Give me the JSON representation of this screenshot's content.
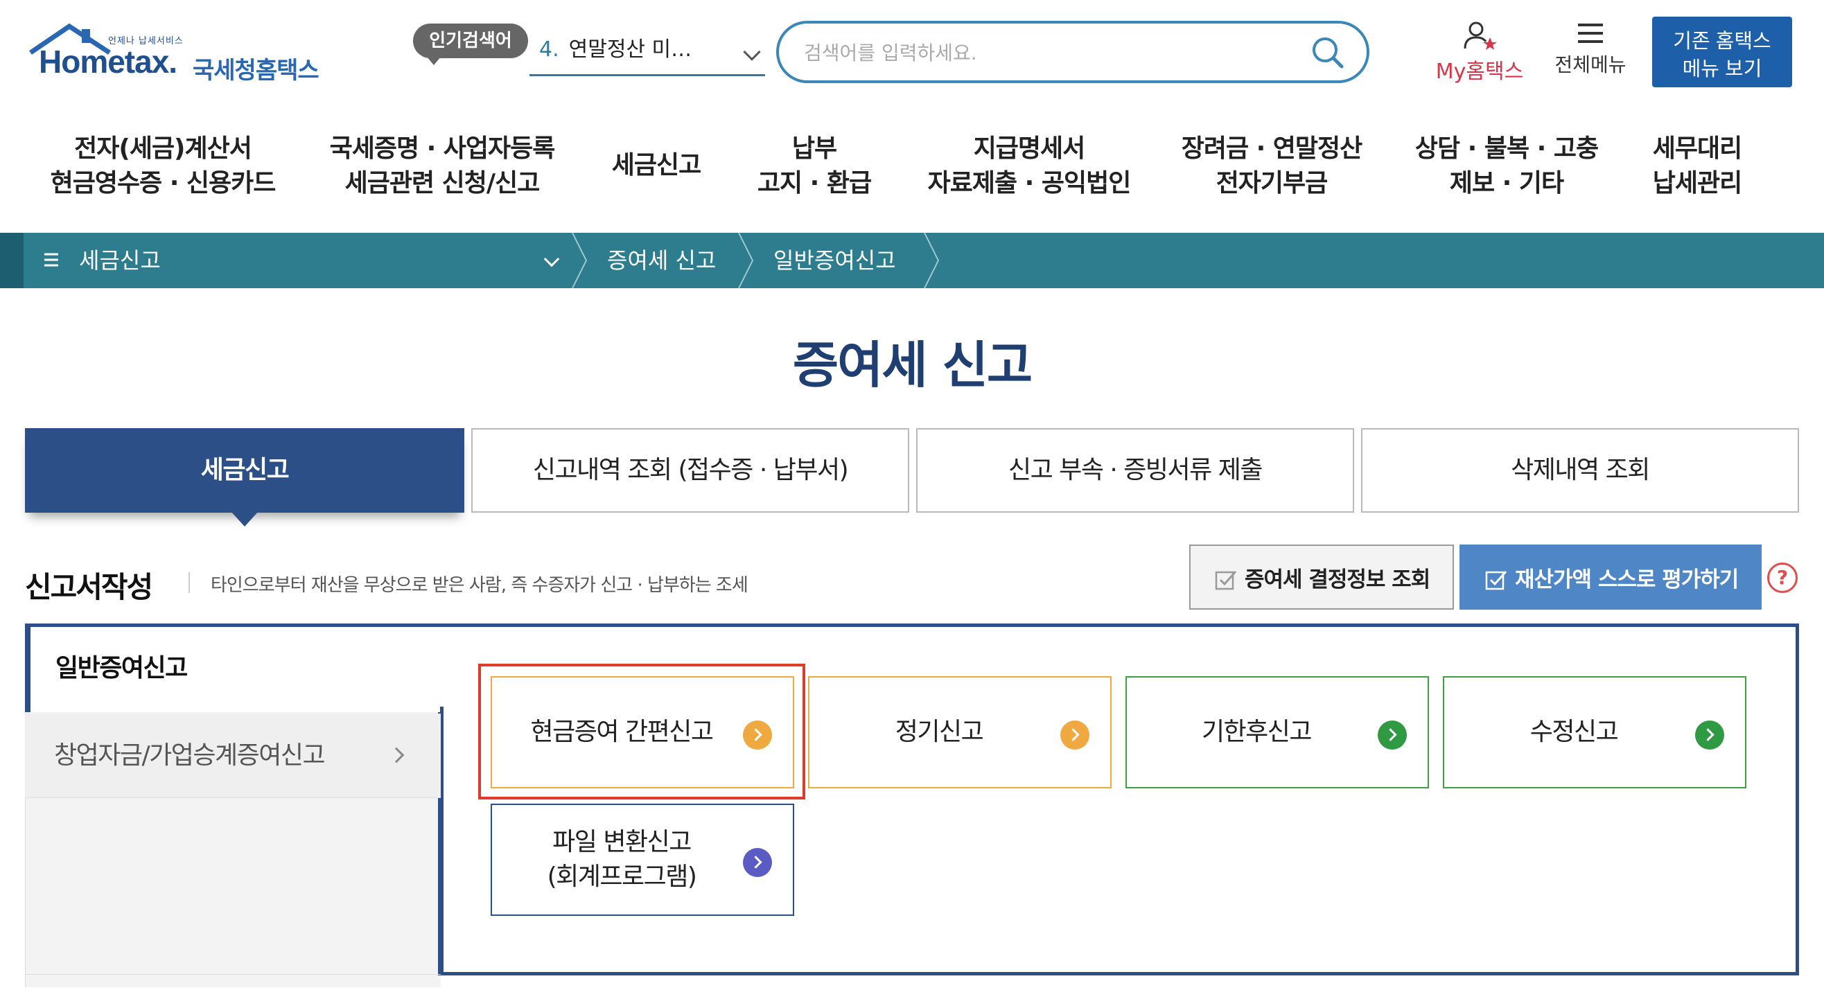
{
  "header": {
    "logo_small": "언제나 납세서비스",
    "logo_main": "Hometax.",
    "logo_kr": "국세청홈택스",
    "popular_badge": "인기검색어",
    "popular_number": "4.",
    "popular_text": "연말정산 미…",
    "search_placeholder": "검색어를 입력하세요.",
    "my_hometax": "My홈택스",
    "all_menu": "전체메뉴",
    "old_menu_btn": "기존 홈택스\n메뉴 보기"
  },
  "gnb": [
    {
      "label": "전자(세금)계산서\n현금영수증 · 신용카드"
    },
    {
      "label": "국세증명 · 사업자등록\n세금관련 신청/신고"
    },
    {
      "label": "세금신고"
    },
    {
      "label": "납부\n고지 · 환급"
    },
    {
      "label": "지급명세서\n자료제출 · 공익법인"
    },
    {
      "label": "장려금 · 연말정산\n전자기부금"
    },
    {
      "label": "상담 · 불복 · 고충\n제보 · 기타"
    },
    {
      "label": "세무대리\n납세관리"
    }
  ],
  "breadcrumb": {
    "first": "세금신고",
    "items": [
      "증여세 신고",
      "일반증여신고"
    ]
  },
  "page_title": "증여세 신고",
  "tabs": [
    {
      "label": "세금신고",
      "active": true
    },
    {
      "label": "신고내역 조회 (접수증 · 납부서)",
      "active": false
    },
    {
      "label": "신고 부속 · 증빙서류 제출",
      "active": false
    },
    {
      "label": "삭제내역 조회",
      "active": false
    }
  ],
  "section": {
    "title": "신고서작성",
    "description": "타인으로부터 재산을 무상으로 받은 사람, 즉 수증자가 신고 · 납부하는 조세",
    "btn_decision": "증여세 결정정보 조회",
    "btn_selfeval": "재산가액 스스로 평가하기",
    "help": "?"
  },
  "sidebar": {
    "active": "일반증여신고",
    "items": [
      "창업자금/가업승계증여신고"
    ]
  },
  "cards": [
    {
      "label": "현금증여 간편신고",
      "color": "orange"
    },
    {
      "label": "정기신고",
      "color": "orange"
    },
    {
      "label": "기한후신고",
      "color": "green"
    },
    {
      "label": "수정신고",
      "color": "green"
    },
    {
      "label": "파일 변환신고\n(회계프로그램)",
      "color": "blue"
    }
  ],
  "colors": {
    "brand_navy": "#2b4f86",
    "breadcrumb_teal": "#2d7d8f",
    "highlight_red": "#e03a2a",
    "orange": "#f0a940",
    "green": "#2f9a41"
  }
}
